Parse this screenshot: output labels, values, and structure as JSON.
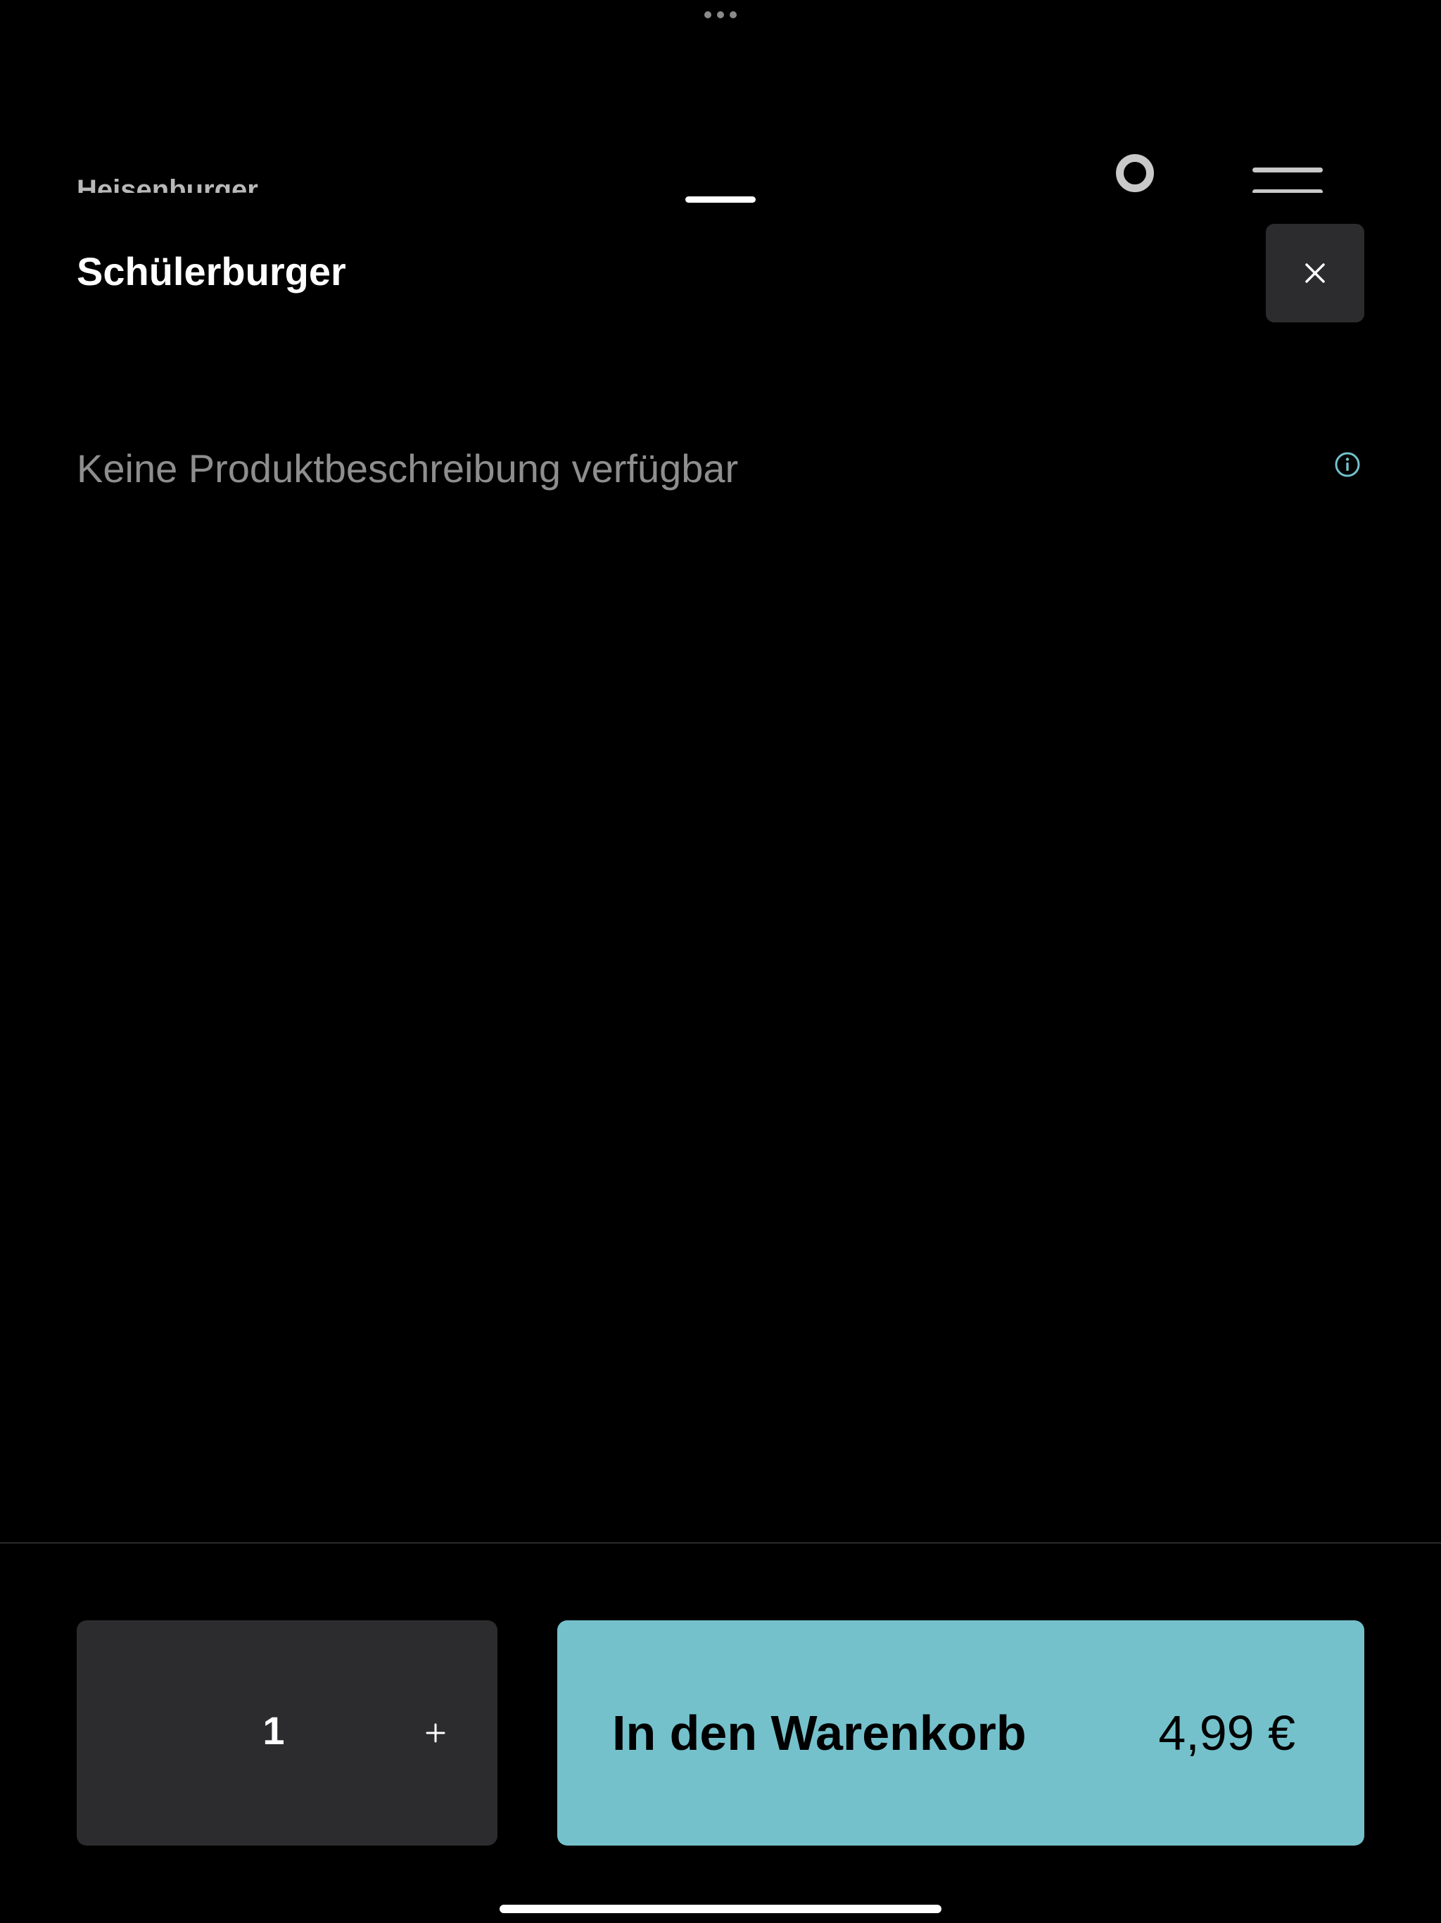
{
  "background_app": {
    "title": "Heisenburger"
  },
  "product_sheet": {
    "title": "Schülerburger",
    "description": "Keine Produktbeschreibung verfügbar"
  },
  "quantity_stepper": {
    "value": "1",
    "plus_label": "+"
  },
  "add_to_cart": {
    "label": "In den Warenkorb",
    "price": "4,99 €"
  },
  "icons": {
    "close": "close-icon",
    "info": "info-icon",
    "plus": "plus-icon"
  },
  "colors": {
    "background": "#000000",
    "panel": "#2c2c2e",
    "accent": "#74c1cc",
    "muted_text": "#8e8e8e"
  }
}
